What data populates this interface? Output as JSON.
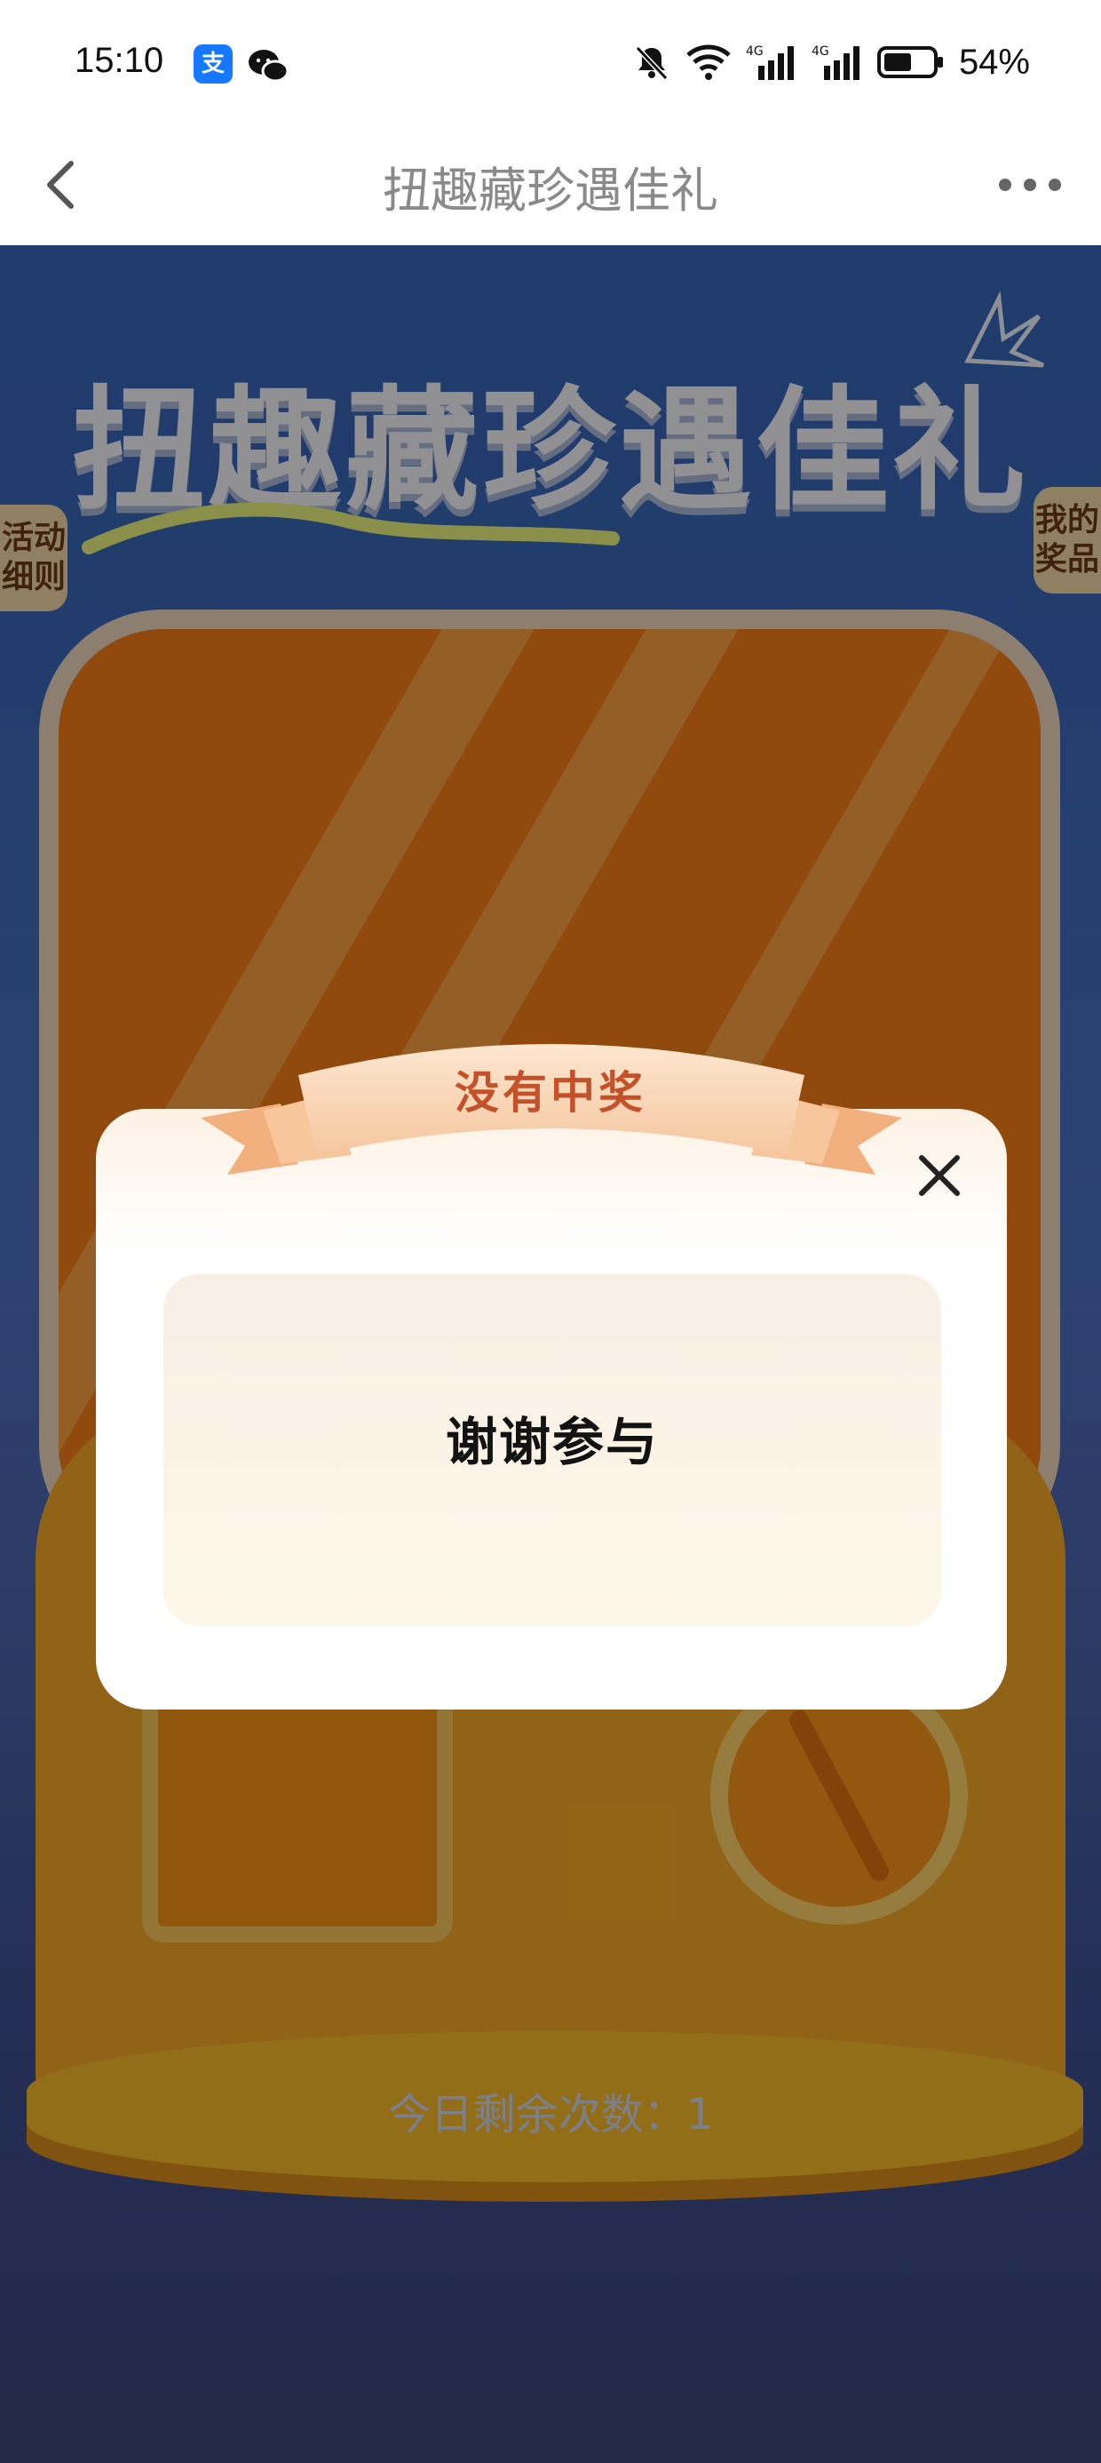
{
  "status_bar": {
    "time": "15:10",
    "apps": [
      "alipay-icon",
      "wechat-icon"
    ],
    "battery": "54%",
    "icons": [
      "bell-muted-icon",
      "wifi-icon",
      "signal-4g-icon",
      "signal-4g-icon",
      "battery-icon"
    ],
    "network_labels": [
      "4G",
      "4G"
    ]
  },
  "nav": {
    "title": "扭趣藏珍遇佳礼",
    "back_icon": "chevron-left-icon",
    "more_icon": "more-dots-icon"
  },
  "page": {
    "hero_title": "扭趣藏珍遇佳礼",
    "left_tab": "活动细则",
    "right_tab": "我的奖品",
    "remaining_label": "今日剩余次数：1"
  },
  "modal": {
    "ribbon_title": "没有中奖",
    "message": "谢谢参与",
    "close_icon": "close-icon"
  },
  "colors": {
    "page_blue": "#3564b4",
    "machine_orange": "#f07c16",
    "ribbon_text": "#c3512a",
    "message_bg": "#f7efe3"
  }
}
